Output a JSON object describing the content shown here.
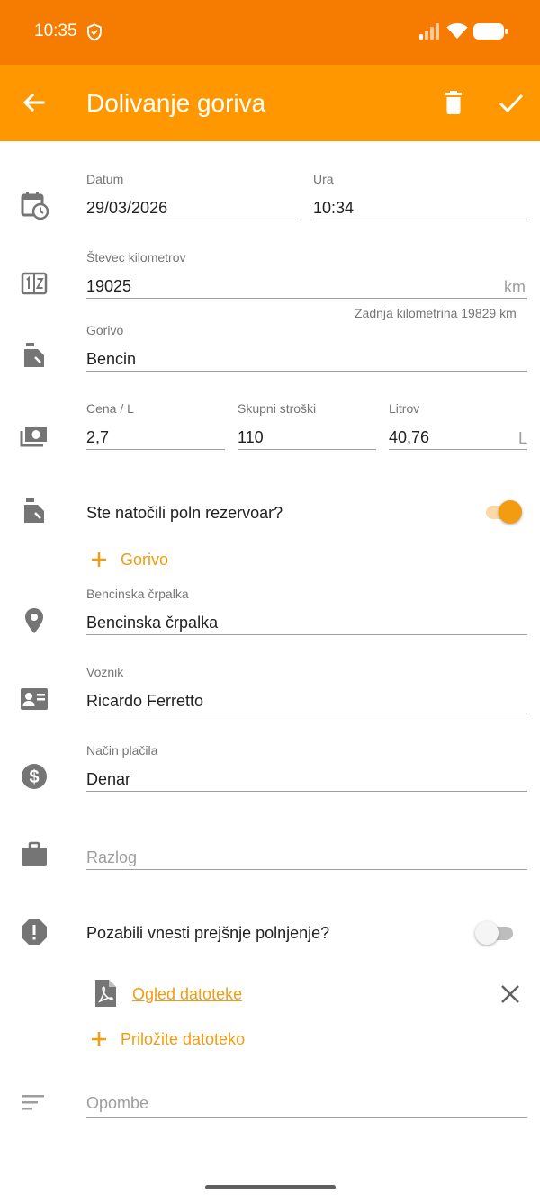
{
  "status_bar": {
    "time": "10:35",
    "icons": [
      "shield-icon",
      "signal-icon",
      "wifi-icon",
      "battery-icon"
    ]
  },
  "app_bar": {
    "title": "Dolivanje goriva",
    "icons": [
      "back-arrow-icon",
      "delete-icon",
      "check-icon"
    ]
  },
  "colors": {
    "status_bar": "#f57c00",
    "app_bar": "#ff9800",
    "accent": "#f39c12",
    "toggle_on_thumb": "#f39c12",
    "toggle_on_track": "#fbd9a8",
    "toggle_off_thumb": "#f5f5f5",
    "toggle_off_track": "#bdbdbd"
  },
  "form": {
    "date": {
      "label": "Datum",
      "value": "29/03/2026",
      "icon": "calendar-clock-icon"
    },
    "time": {
      "label": "Ura",
      "value": "10:34"
    },
    "odometer": {
      "label": "Števec kilometrov",
      "value": "19025",
      "unit": "km",
      "hint": "Zadnja kilometrina 19829 km",
      "icon": "odometer-icon"
    },
    "fuel": {
      "label": "Gorivo",
      "value": "Bencin",
      "icon": "fuel-can-icon"
    },
    "price_per_liter": {
      "label": "Cena / L",
      "value": "2,7",
      "icon": "money-icon"
    },
    "total_cost": {
      "label": "Skupni stroški",
      "value": "110"
    },
    "liters": {
      "label": "Litrov",
      "value": "40,76",
      "unit": "L"
    },
    "full_tank": {
      "label": "Ste natočili poln rezervoar?",
      "checked": true,
      "icon": "fuel-can-icon"
    },
    "add_fuel": {
      "label": "Gorivo",
      "icon": "plus-icon"
    },
    "station": {
      "label": "Bencinska črpalka",
      "value": "Bencinska črpalka",
      "icon": "location-pin-icon"
    },
    "driver": {
      "label": "Voznik",
      "value": "Ricardo Ferretto",
      "icon": "driver-card-icon"
    },
    "payment": {
      "label": "Način plačila",
      "value": "Denar",
      "icon": "dollar-circle-icon"
    },
    "reason": {
      "placeholder": "Razlog",
      "icon": "briefcase-icon"
    },
    "forgot_previous": {
      "label": "Pozabili vnesti prejšnje polnjenje?",
      "checked": false,
      "icon": "warning-octagon-icon"
    },
    "attachment": {
      "label": "Ogled datoteke",
      "icon": "pdf-file-icon",
      "remove_icon": "close-icon"
    },
    "attach_file": {
      "label": "Priložite datoteko",
      "icon": "plus-icon"
    },
    "notes": {
      "placeholder": "Opombe",
      "icon": "notes-icon"
    }
  }
}
